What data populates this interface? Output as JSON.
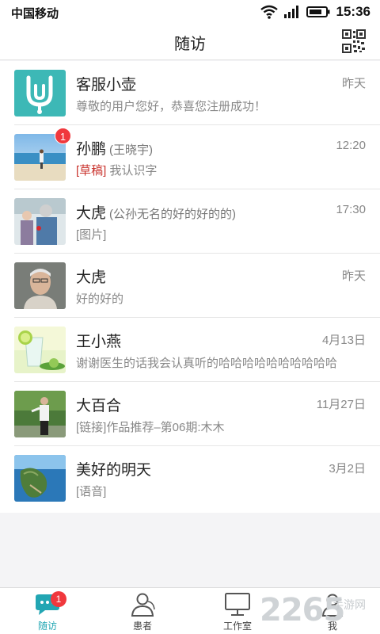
{
  "statusbar": {
    "carrier": "中国移动",
    "time": "15:36"
  },
  "header": {
    "title": "随访"
  },
  "conversations": [
    {
      "name": "客服小壶",
      "alias": "",
      "time": "昨天",
      "tag": "",
      "preview": "尊敬的用户您好，恭喜您注册成功！",
      "badge": ""
    },
    {
      "name": "孙鹏",
      "alias": "(王晓宇)",
      "time": "12:20",
      "tag": "[草稿]",
      "preview": "我认识字",
      "badge": "1"
    },
    {
      "name": "大虎",
      "alias": "(公孙无名的好的好的的)",
      "time": "17:30",
      "tag": "",
      "preview": "[图片]",
      "badge": ""
    },
    {
      "name": "大虎",
      "alias": "",
      "time": "昨天",
      "tag": "",
      "preview": "好的好的",
      "badge": ""
    },
    {
      "name": "王小燕",
      "alias": "",
      "time": "4月13日",
      "tag": "",
      "preview": "谢谢医生的话我会认真听的哈哈哈哈哈哈哈哈哈哈",
      "badge": ""
    },
    {
      "name": "大百合",
      "alias": "",
      "time": "11月27日",
      "tag": "",
      "preview": "[链接]作品推荐–第06期:木木",
      "badge": ""
    },
    {
      "name": "美好的明天",
      "alias": "",
      "time": "3月2日",
      "tag": "",
      "preview": "[语音]",
      "badge": ""
    }
  ],
  "tabbar": {
    "items": [
      {
        "label": "随访",
        "icon": "chat-bubble-icon",
        "active": true,
        "badge": "1"
      },
      {
        "label": "患者",
        "icon": "person-icon",
        "active": false,
        "badge": ""
      },
      {
        "label": "工作室",
        "icon": "monitor-icon",
        "active": false,
        "badge": ""
      },
      {
        "label": "我",
        "icon": "user-icon",
        "active": false,
        "badge": ""
      }
    ]
  },
  "watermark": {
    "number": "2265",
    "text": "手游网"
  },
  "colors": {
    "accent": "#22a6b3",
    "badge": "#f0383d",
    "draft": "#c9322c"
  }
}
